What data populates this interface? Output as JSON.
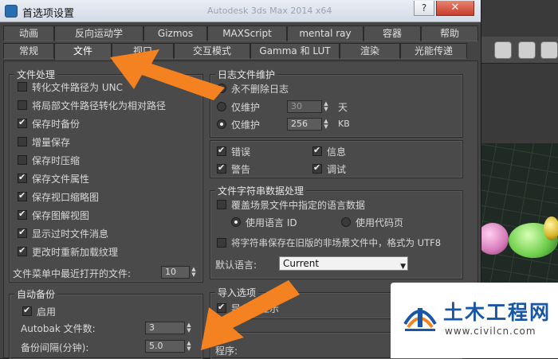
{
  "window": {
    "title": "首选项设置",
    "ghost_title": "Autodesk 3ds Max 2014 x64"
  },
  "tabs_row1": [
    "动画",
    "反向运动学",
    "Gizmos",
    "MAXScript",
    "mental ray",
    "容器",
    "帮助"
  ],
  "tabs_row2": [
    "常规",
    "文件",
    "视口",
    "交互模式",
    "Gamma 和 LUT",
    "渲染",
    "光能传递"
  ],
  "active_tab": "文件",
  "file_handling": {
    "label": "文件处理",
    "items": [
      {
        "label": "转化文件路径为 UNC",
        "checked": false
      },
      {
        "label": "将局部文件路径转化为相对路径",
        "checked": false
      },
      {
        "label": "保存时备份",
        "checked": true
      },
      {
        "label": "增量保存",
        "checked": false
      },
      {
        "label": "保存时压缩",
        "checked": false
      },
      {
        "label": "保存文件属性",
        "checked": true
      },
      {
        "label": "保存视口缩略图",
        "checked": true
      },
      {
        "label": "保存图解视图",
        "checked": true
      },
      {
        "label": "显示过时文件消息",
        "checked": true
      },
      {
        "label": "更改时重新加载纹理",
        "checked": true
      }
    ],
    "recent_label": "文件菜单中最近打开的文件:",
    "recent_value": "10"
  },
  "log_maintenance": {
    "label": "日志文件维护",
    "never_delete": "永不删除日志",
    "keep_days_label": "仅维护",
    "keep_days_value": "30",
    "keep_days_unit": "天",
    "keep_kb_label": "仅维护",
    "keep_kb_value": "256",
    "keep_kb_unit": "KB",
    "selected": "kb",
    "flags": [
      {
        "label": "错误",
        "checked": true
      },
      {
        "label": "信息",
        "checked": true
      },
      {
        "label": "警告",
        "checked": true
      },
      {
        "label": "调试",
        "checked": true
      }
    ]
  },
  "string_data": {
    "label": "文件字符串数据处理",
    "override_label": "覆盖场景文件中指定的语言数据",
    "override_checked": false,
    "use_language_id": "使用语言 ID",
    "use_codepage": "使用代码页",
    "language_selected": "id",
    "legacy_label": "将字符串保存在旧版的非场景文件中，格式为 UTF8",
    "legacy_checked": false,
    "default_language_label": "默认语言:",
    "default_language_value": "Current"
  },
  "auto_backup": {
    "label": "自动备份",
    "enable_label": "启用",
    "enable_checked": true,
    "files_label": "Autobak 文件数:",
    "files_value": "3",
    "interval_label": "备份间隔(分钟):",
    "interval_value": "5.0"
  },
  "import_options": {
    "label": "导入选项",
    "show_label": "导入时显示",
    "show_checked": true
  },
  "program_label": "程序:",
  "watermark": {
    "title": "土木工程网",
    "url": "www.civilcn.com"
  },
  "colors": {
    "arrow": "#f58220",
    "panel": "#4a4a4a",
    "logo_blue": "#1957a6"
  }
}
